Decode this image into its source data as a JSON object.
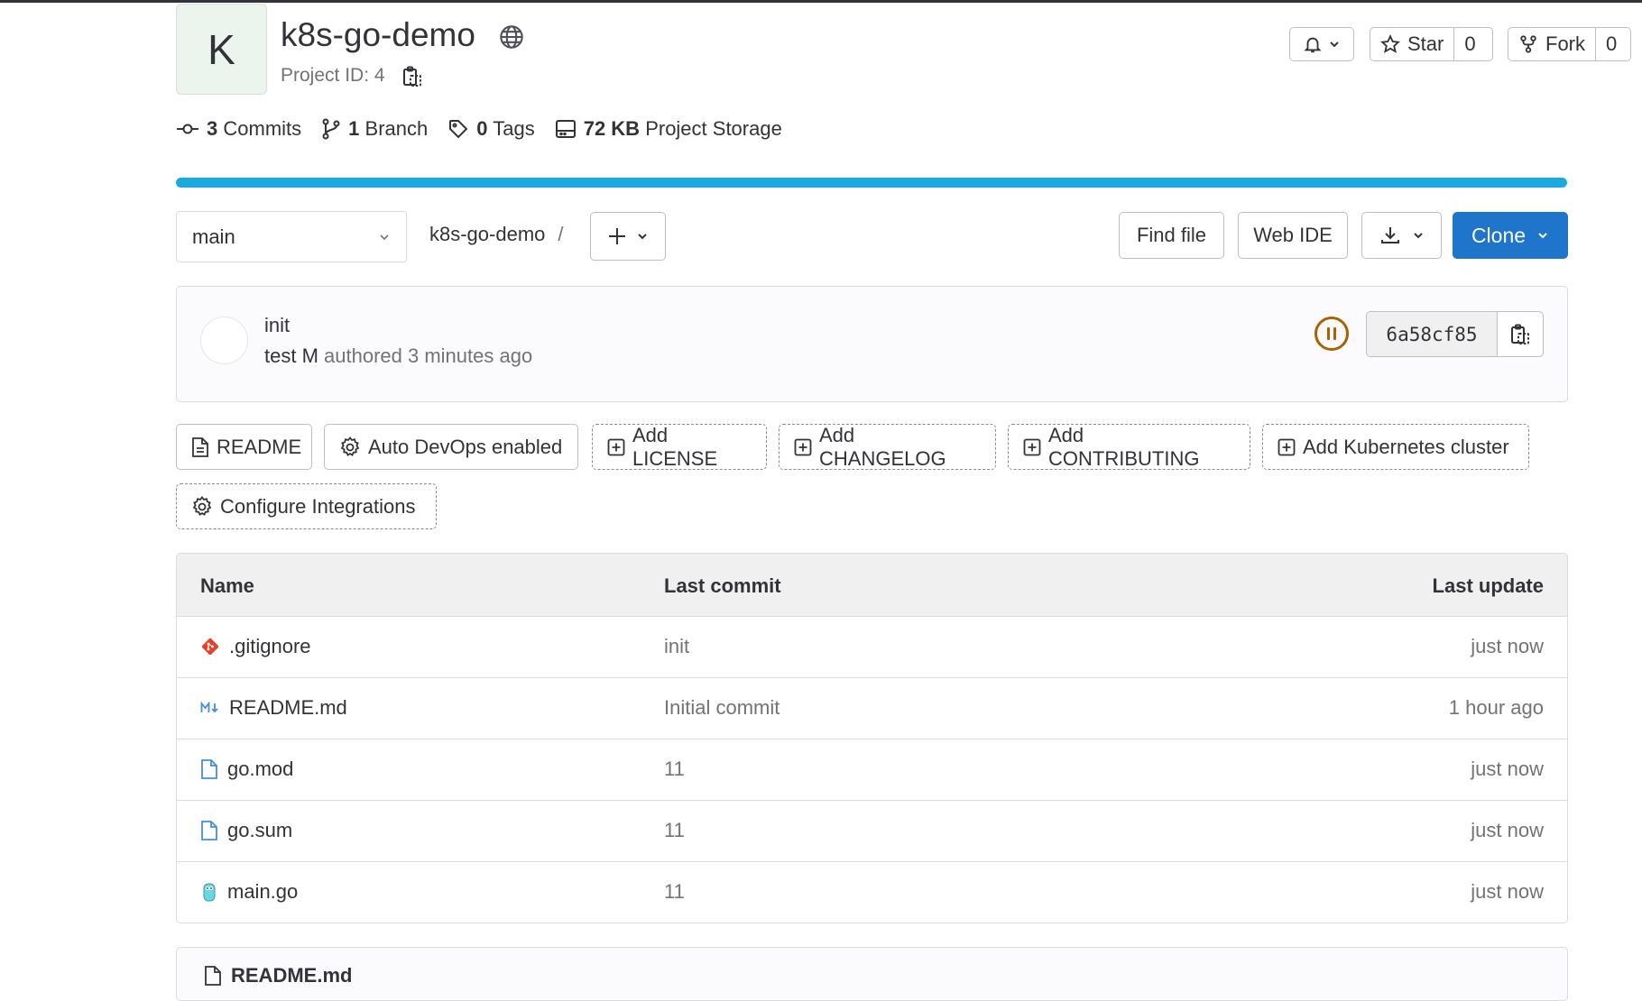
{
  "project": {
    "avatar_letter": "K",
    "name": "k8s-go-demo",
    "id_label": "Project ID: 4",
    "visibility_icon": "globe-icon"
  },
  "header_actions": {
    "star_label": "Star",
    "star_count": "0",
    "fork_label": "Fork",
    "fork_count": "0"
  },
  "stats": {
    "commits_count": "3",
    "commits_label": "Commits",
    "branch_count": "1",
    "branch_label": "Branch",
    "tags_count": "0",
    "tags_label": "Tags",
    "storage_size": "72 KB",
    "storage_label": "Project Storage"
  },
  "storage_bar": {
    "fill_fraction": 1.0,
    "color": "#1aaadf"
  },
  "toolbar": {
    "branch": "main",
    "breadcrumb": "k8s-go-demo",
    "breadcrumb_sep": "/",
    "find_file": "Find file",
    "web_ide": "Web IDE",
    "clone": "Clone",
    "clone_color": "#1f75cb"
  },
  "commit": {
    "title": "init",
    "author": "test M",
    "meta": "authored 3 minutes ago",
    "pipeline_status": "paused",
    "sha": "6a58cf85"
  },
  "quick_actions": [
    {
      "label": "README",
      "icon": "document-icon",
      "style": "solid"
    },
    {
      "label": "Auto DevOps enabled",
      "icon": "gear-icon",
      "style": "solid"
    },
    {
      "label": "Add LICENSE",
      "icon": "plus-square-icon",
      "style": "dashed"
    },
    {
      "label": "Add CHANGELOG",
      "icon": "plus-square-icon",
      "style": "dashed"
    },
    {
      "label": "Add CONTRIBUTING",
      "icon": "plus-square-icon",
      "style": "dashed"
    },
    {
      "label": "Add Kubernetes cluster",
      "icon": "plus-square-icon",
      "style": "dashed"
    },
    {
      "label": "Configure Integrations",
      "icon": "gear-icon",
      "style": "dashed"
    }
  ],
  "files": {
    "headers": {
      "name": "Name",
      "last_commit": "Last commit",
      "last_update": "Last update"
    },
    "rows": [
      {
        "name": ".gitignore",
        "icon": "git-icon",
        "last_commit": "init",
        "last_update": "just now"
      },
      {
        "name": "README.md",
        "icon": "markdown-icon",
        "last_commit": "Initial commit",
        "last_update": "1 hour ago"
      },
      {
        "name": "go.mod",
        "icon": "file-icon",
        "last_commit": "11",
        "last_update": "just now"
      },
      {
        "name": "go.sum",
        "icon": "file-icon",
        "last_commit": "11",
        "last_update": "just now"
      },
      {
        "name": "main.go",
        "icon": "go-gopher-icon",
        "last_commit": "11",
        "last_update": "just now"
      }
    ]
  },
  "readme_card": {
    "label": "README.md"
  }
}
